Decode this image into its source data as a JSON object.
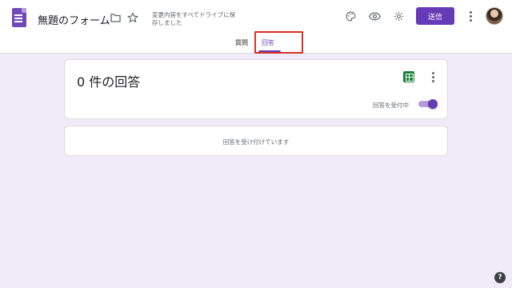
{
  "header": {
    "form_title": "無題のフォーム",
    "save_status": "変更内容をすべてドライブに保存しました",
    "send_label": "送信",
    "icons": [
      "forms-logo-icon",
      "folder-icon",
      "star-icon",
      "palette-icon",
      "preview-eye-icon",
      "settings-gear-icon",
      "more-vert-icon",
      "avatar"
    ]
  },
  "tabs": [
    {
      "label": "質問",
      "active": false
    },
    {
      "label": "回答",
      "active": true
    }
  ],
  "summary_card": {
    "response_count": "0 件の回答",
    "accepting_label": "回答を受付中",
    "accepting": true
  },
  "notice": {
    "text": "回答を受け付けています"
  },
  "colors": {
    "accent": "#673ab7",
    "background": "#f0ebf8",
    "sheets_green": "#188038",
    "highlight": "#d93025"
  }
}
